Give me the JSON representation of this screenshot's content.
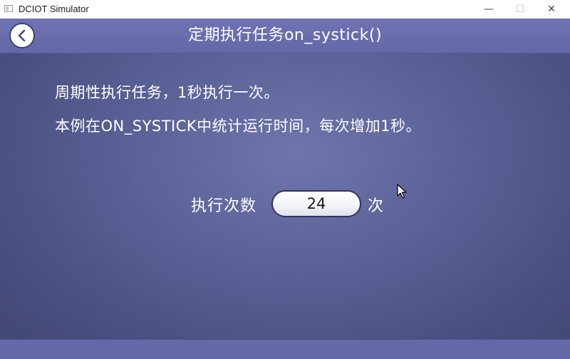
{
  "window": {
    "title": "DCIOT Simulator",
    "minimize_glyph": "—",
    "maximize_glyph": "☐",
    "close_glyph": "✕"
  },
  "header": {
    "title": "定期执行任务on_systick()",
    "back_icon": "chevron-left-icon"
  },
  "description": {
    "line1": "周期性执行任务，1秒执行一次。",
    "line2": "本例在ON_SYSTICK中统计运行时间，每次增加1秒。"
  },
  "counter": {
    "label": "执行次数",
    "value": "24",
    "unit": "次"
  },
  "colors": {
    "header": "#6468a7",
    "background": "#5b6299",
    "footer": "#6569a8",
    "text": "#ffffff"
  }
}
